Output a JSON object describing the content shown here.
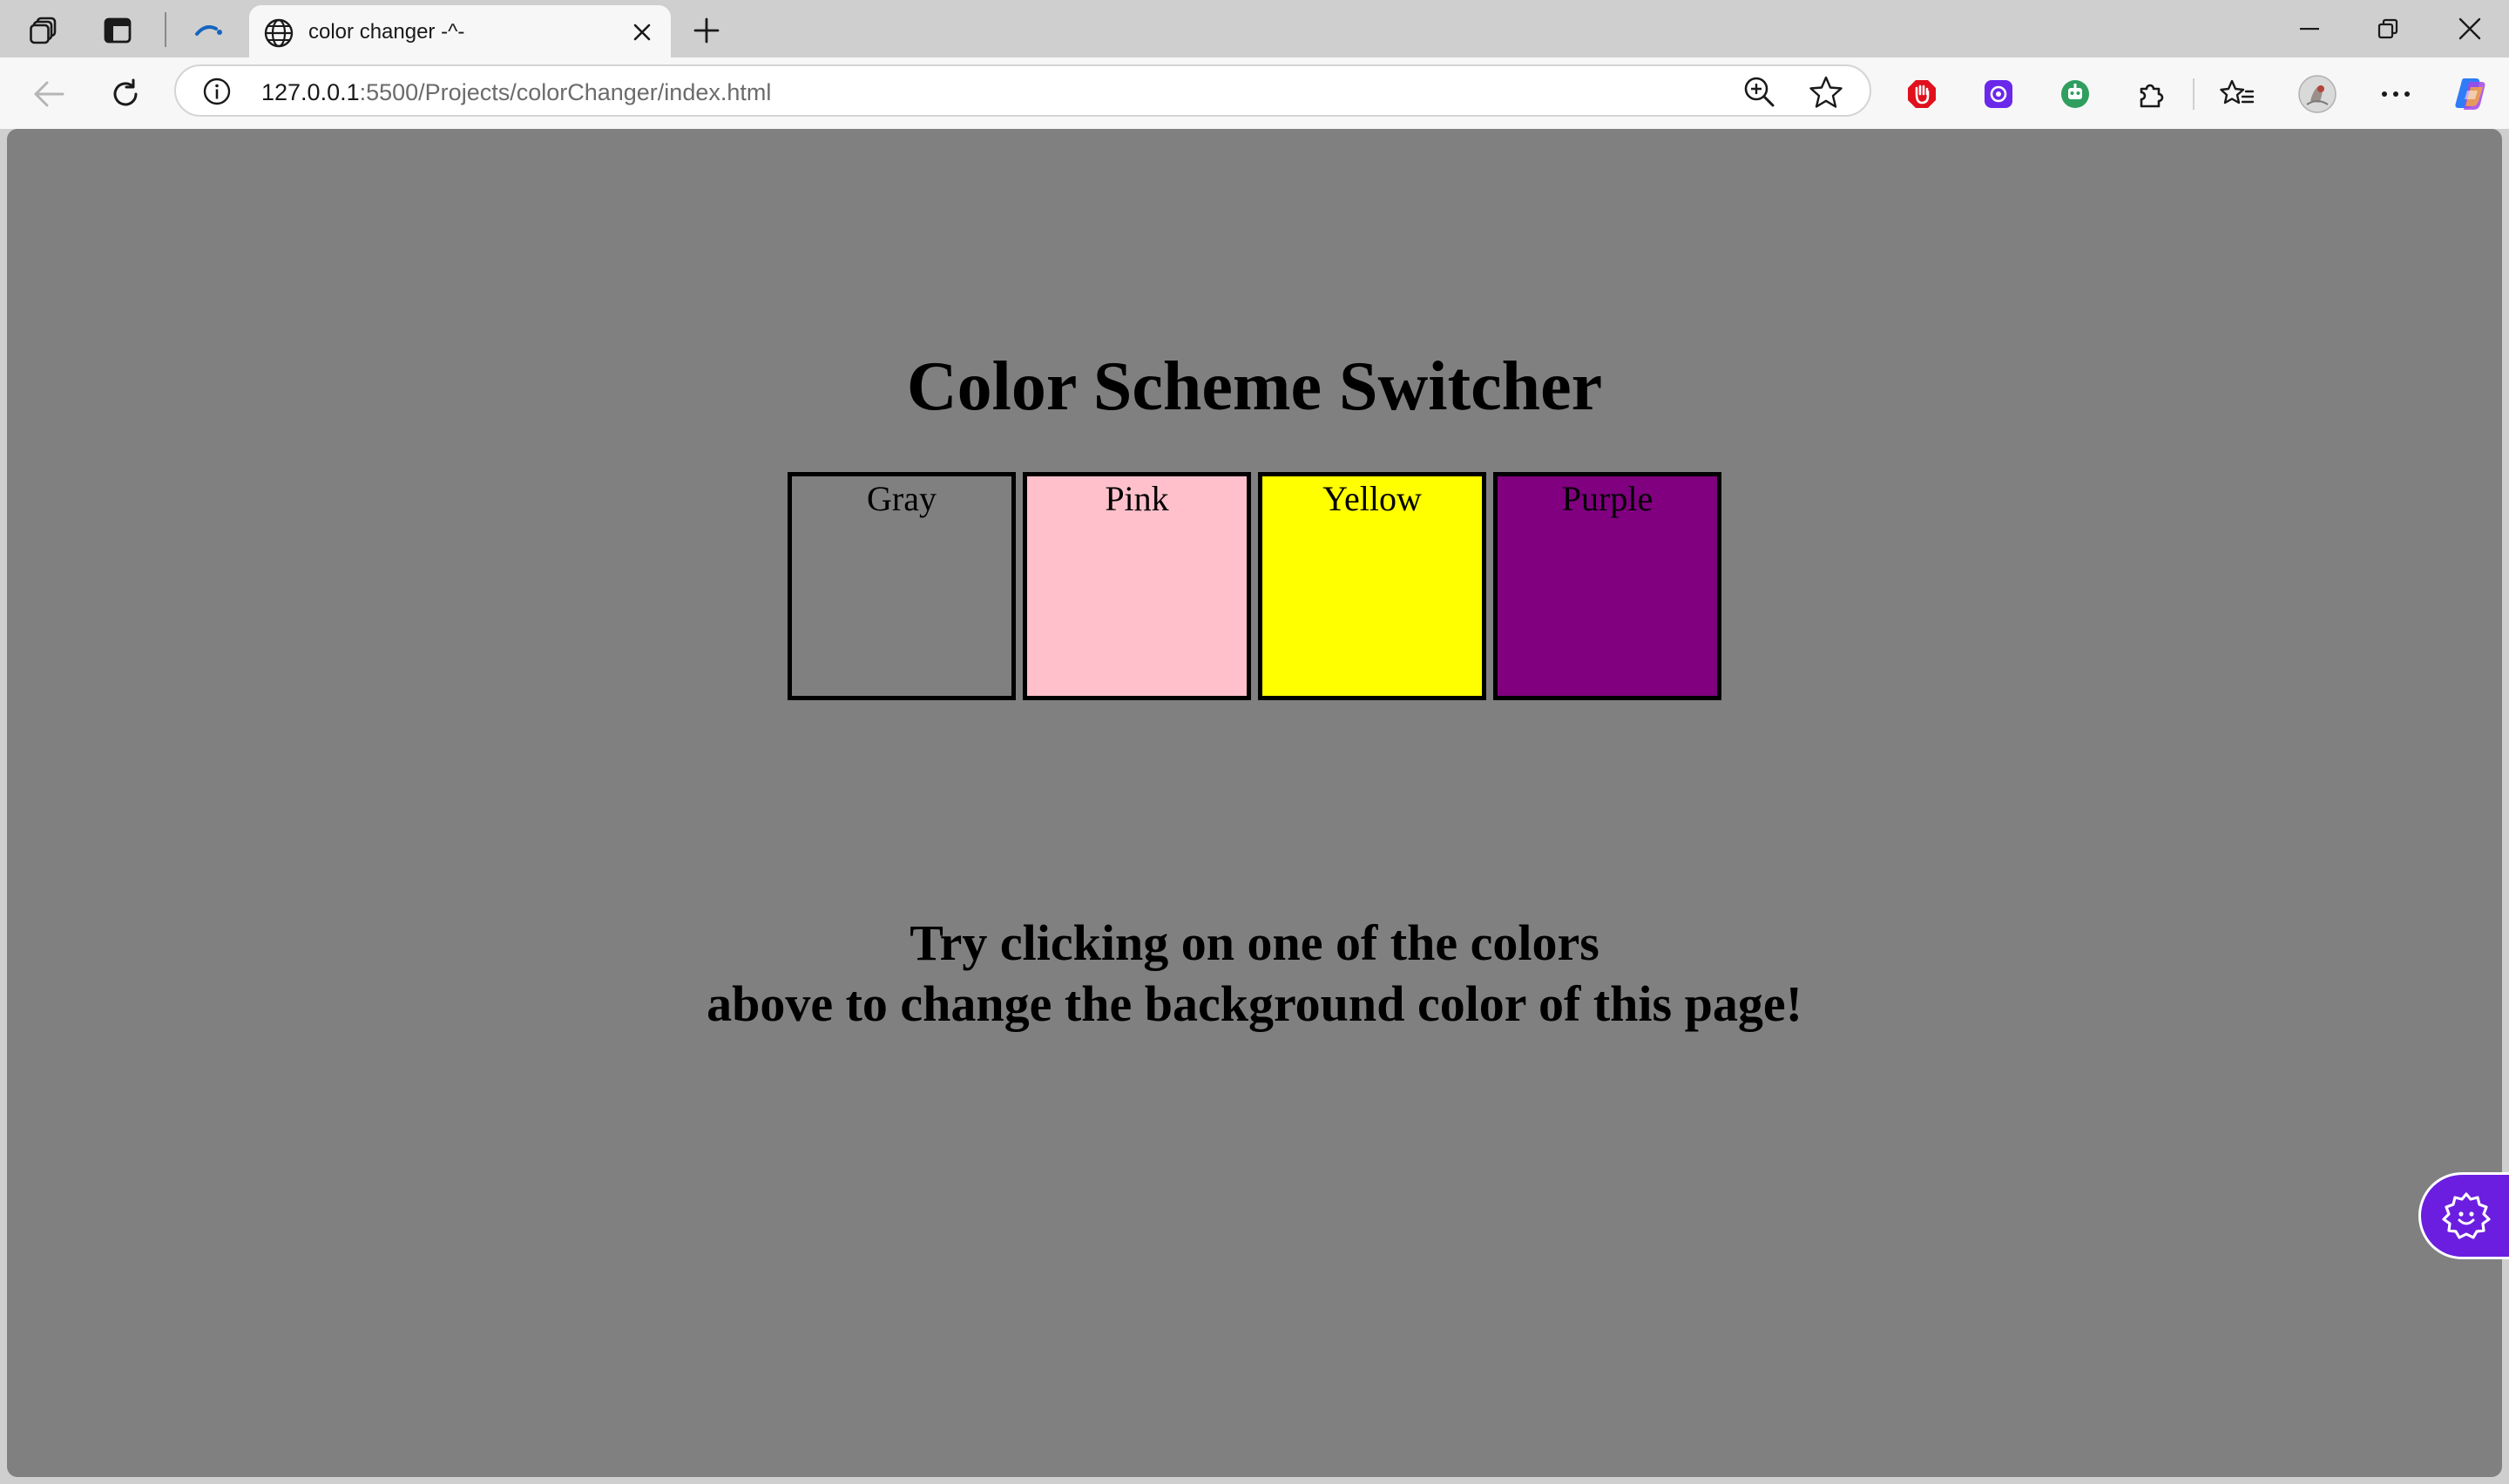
{
  "browser": {
    "tab_title": "color changer -^-",
    "url_host": "127.0.0.1",
    "url_path": ":5500/Projects/colorChanger/index.html"
  },
  "page": {
    "heading": "Color Scheme Switcher",
    "swatches": [
      {
        "label": "Gray",
        "color": "#808080"
      },
      {
        "label": "Pink",
        "color": "#ffc0cb"
      },
      {
        "label": "Yellow",
        "color": "#ffff00"
      },
      {
        "label": "Purple",
        "color": "#800080"
      }
    ],
    "message_line1": "Try clicking on one of the colors",
    "message_line2": "above to change the background color of this page!",
    "background_color": "#808080"
  },
  "icons": {
    "workspaces": "workspaces-icon",
    "tab_actions": "tab-actions-icon",
    "loading": "loading-icon",
    "globe": "globe-icon",
    "close_tab": "close-icon",
    "new_tab": "plus-icon",
    "minimize": "minimize-icon",
    "restore": "restore-icon",
    "close_window": "close-icon",
    "back": "back-arrow-icon",
    "refresh": "refresh-icon",
    "site_info": "info-icon",
    "zoom": "zoom-in-icon",
    "favorite": "star-icon",
    "ext_red": "stop-extension-icon",
    "ext_purple": "purple-extension-icon",
    "ext_green": "robot-extension-icon",
    "extensions": "puzzle-icon",
    "favorites": "favorites-list-icon",
    "profile": "avatar-icon",
    "more": "more-dots-icon",
    "copilot": "copilot-icon",
    "floating": "gear-smile-icon"
  }
}
